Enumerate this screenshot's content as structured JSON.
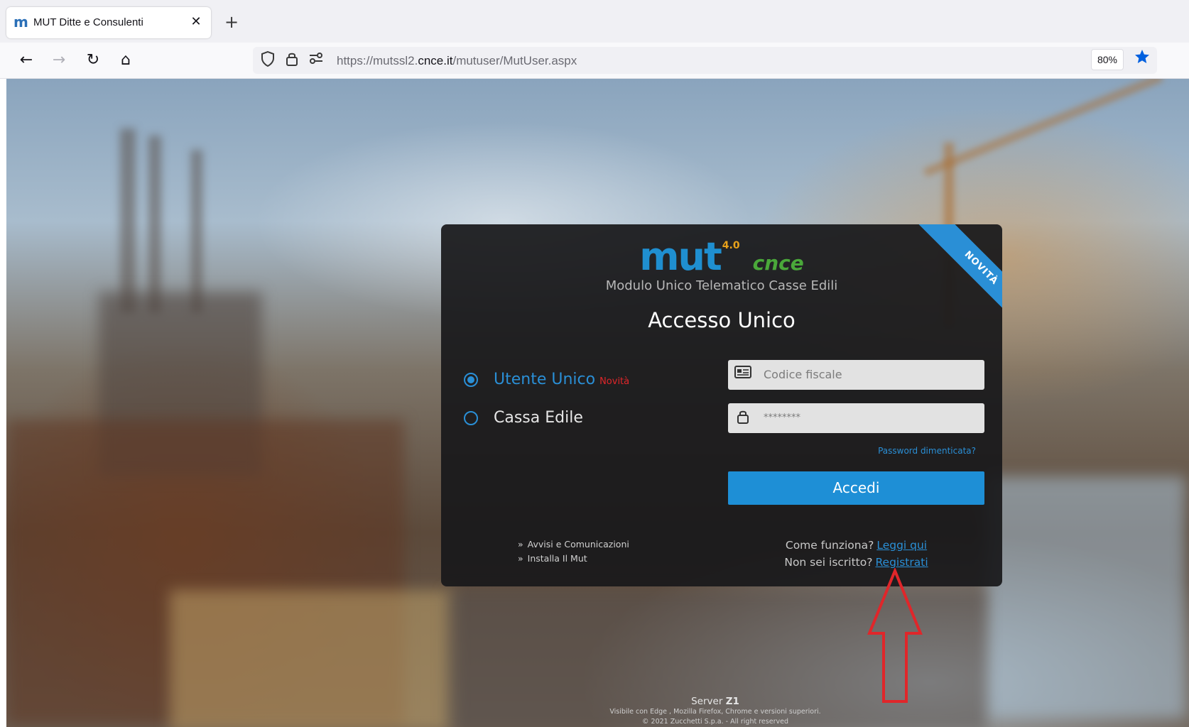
{
  "browser": {
    "tab": {
      "favicon_glyph": "m",
      "title": "MUT Ditte e Consulenti",
      "close_glyph": "✕"
    },
    "new_tab_glyph": "+",
    "nav": {
      "back_glyph": "←",
      "forward_glyph": "→",
      "reload_glyph": "↻",
      "home_glyph": "⌂"
    },
    "url": {
      "prefix": "https://mutssl2.",
      "host": "cnce.it",
      "path": "/mutuser/MutUser.aspx"
    },
    "zoom": "80%",
    "icons": {
      "shield": "shield-icon",
      "lock": "lock-icon",
      "permissions": "permissions-icon",
      "bookmark": "star-icon"
    },
    "accent_color": "#0060df"
  },
  "login": {
    "ribbon": "NOVITÀ",
    "logo": {
      "mut": "mut",
      "version": "4.0",
      "partner": "cnce"
    },
    "subtitle": "Modulo Unico Telematico Casse Edili",
    "heading": "Accesso Unico",
    "options": [
      {
        "label": "Utente Unico",
        "tag": "Novità",
        "checked": true
      },
      {
        "label": "Cassa Edile",
        "tag": "",
        "checked": false
      }
    ],
    "fields": {
      "fiscal_code_placeholder": "Codice fiscale",
      "password_value": "********"
    },
    "forgot_password": "Password dimenticata?",
    "submit_label": "Accedi",
    "side_links": [
      {
        "arrow": "»",
        "label": "Avvisi e Comunicazioni"
      },
      {
        "arrow": "»",
        "label": "Installa Il Mut"
      }
    ],
    "help": {
      "how_text": "Come funziona?",
      "how_link": "Leggi qui",
      "register_text": "Non sei iscritto?",
      "register_link": "Registrati"
    },
    "colors": {
      "accent": "#2a8fd6",
      "tag": "#e0262a",
      "card": "#19191b"
    }
  },
  "footer": {
    "server_label": "Server",
    "server_id": "Z1",
    "compat": "Visibile con Edge , Mozilla Firefox, Chrome e versioni superiori.",
    "copyright": "© 2021 Zucchetti S.p.a. - All right reserved"
  },
  "annotation": {
    "arrow_color": "#e0262a"
  }
}
